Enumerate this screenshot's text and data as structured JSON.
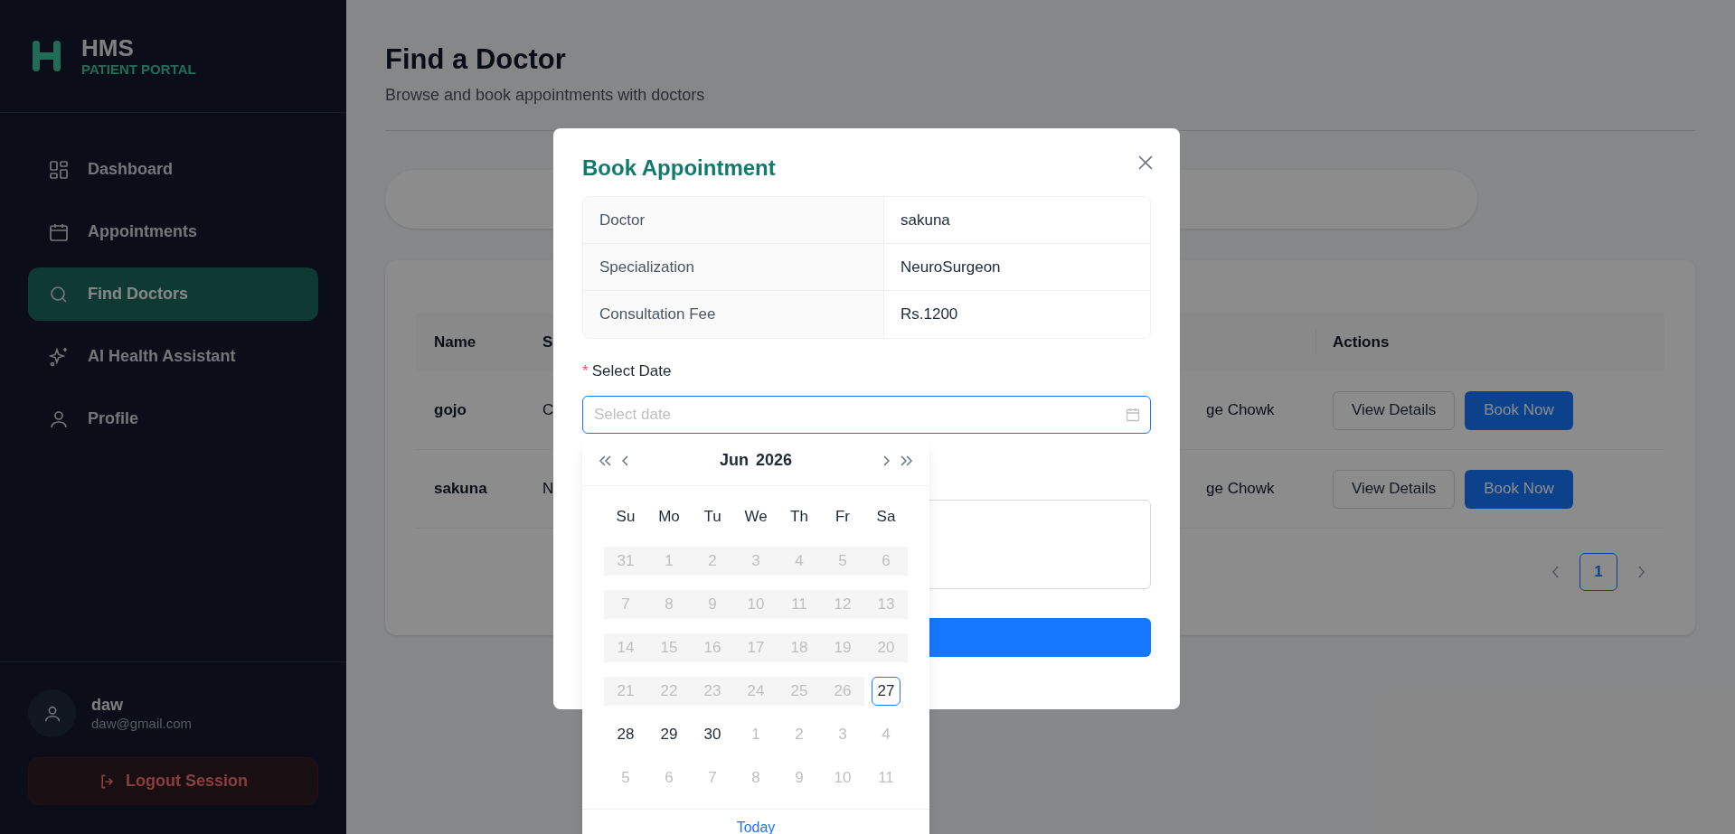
{
  "sidebar": {
    "brand": {
      "name": "HMS",
      "tagline": "PATIENT PORTAL"
    },
    "nav": [
      {
        "label": "Dashboard",
        "selected": false
      },
      {
        "label": "Appointments",
        "selected": false
      },
      {
        "label": "Find Doctors",
        "selected": true
      },
      {
        "label": "AI Health Assistant",
        "selected": false
      },
      {
        "label": "Profile",
        "selected": false
      }
    ],
    "user": {
      "name": "daw",
      "email": "daw@gmail.com"
    },
    "logout": "Logout Session"
  },
  "page": {
    "title": "Find a Doctor",
    "subtitle": "Browse and book appointments with doctors"
  },
  "table": {
    "columns": [
      "Name",
      "S",
      "Actions"
    ],
    "rows": [
      {
        "name": "gojo",
        "column_2": "C",
        "column_4": "ge Chowk",
        "actions": [
          "View Details",
          "Book Now"
        ]
      },
      {
        "name": "sakuna",
        "column_2": "N",
        "column_4": "ge Chowk",
        "actions": [
          "View Details",
          "Book Now"
        ]
      }
    ]
  },
  "pagination": {
    "pages": [
      {
        "label": "1",
        "selected": true
      }
    ]
  },
  "modal": {
    "title": "Book Appointment",
    "details": [
      {
        "label": "Doctor",
        "value": "sakuna"
      },
      {
        "label": "Specialization",
        "value": "NeuroSurgeon"
      },
      {
        "label": "Consultation Fee",
        "value": "Rs.1200"
      }
    ],
    "required_mark": "*",
    "date_label": "Select Date",
    "date_placeholder": "Select date",
    "calendar": {
      "month": "Jun",
      "year": "2026",
      "weekdays": [
        "Su",
        "Mo",
        "Tu",
        "We",
        "Th",
        "Fr",
        "Sa"
      ],
      "weeks": [
        [
          {
            "day": "31",
            "kind": "disabled"
          },
          {
            "day": "1",
            "kind": "disabled"
          },
          {
            "day": "2",
            "kind": "disabled"
          },
          {
            "day": "3",
            "kind": "disabled"
          },
          {
            "day": "4",
            "kind": "disabled"
          },
          {
            "day": "5",
            "kind": "disabled"
          },
          {
            "day": "6",
            "kind": "disabled"
          }
        ],
        [
          {
            "day": "7",
            "kind": "disabled"
          },
          {
            "day": "8",
            "kind": "disabled"
          },
          {
            "day": "9",
            "kind": "disabled"
          },
          {
            "day": "10",
            "kind": "disabled"
          },
          {
            "day": "11",
            "kind": "disabled"
          },
          {
            "day": "12",
            "kind": "disabled"
          },
          {
            "day": "13",
            "kind": "disabled"
          }
        ],
        [
          {
            "day": "14",
            "kind": "disabled"
          },
          {
            "day": "15",
            "kind": "disabled"
          },
          {
            "day": "16",
            "kind": "disabled"
          },
          {
            "day": "17",
            "kind": "disabled"
          },
          {
            "day": "18",
            "kind": "disabled"
          },
          {
            "day": "19",
            "kind": "disabled"
          },
          {
            "day": "20",
            "kind": "disabled"
          }
        ],
        [
          {
            "day": "21",
            "kind": "disabled"
          },
          {
            "day": "22",
            "kind": "disabled"
          },
          {
            "day": "23",
            "kind": "disabled"
          },
          {
            "day": "24",
            "kind": "disabled"
          },
          {
            "day": "25",
            "kind": "disabled"
          },
          {
            "day": "26",
            "kind": "disabled"
          },
          {
            "day": "27",
            "kind": "today"
          }
        ],
        [
          {
            "day": "28",
            "kind": "available"
          },
          {
            "day": "29",
            "kind": "available"
          },
          {
            "day": "30",
            "kind": "available"
          },
          {
            "day": "1",
            "kind": "outside"
          },
          {
            "day": "2",
            "kind": "outside"
          },
          {
            "day": "3",
            "kind": "outside"
          },
          {
            "day": "4",
            "kind": "outside"
          }
        ],
        [
          {
            "day": "5",
            "kind": "outside"
          },
          {
            "day": "6",
            "kind": "outside"
          },
          {
            "day": "7",
            "kind": "outside"
          },
          {
            "day": "8",
            "kind": "outside"
          },
          {
            "day": "9",
            "kind": "outside"
          },
          {
            "day": "10",
            "kind": "outside"
          },
          {
            "day": "11",
            "kind": "outside"
          }
        ]
      ],
      "footer": "Today"
    }
  }
}
